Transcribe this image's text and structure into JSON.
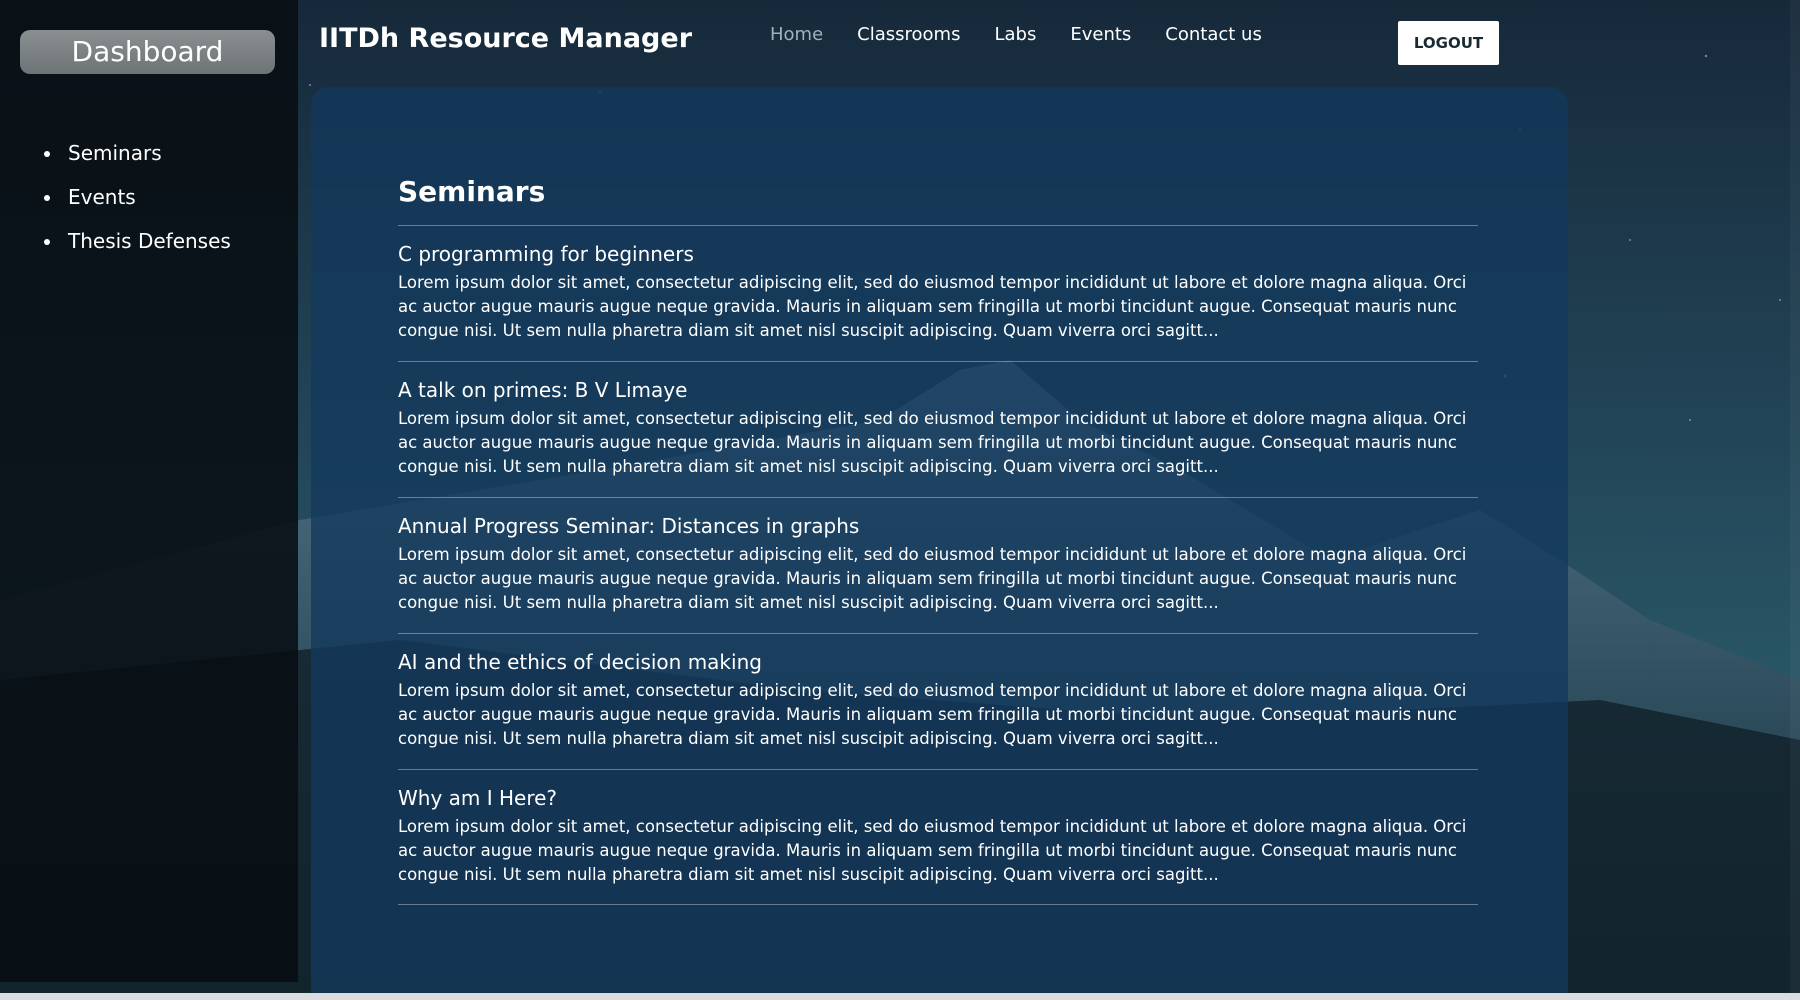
{
  "app": {
    "brand": "IITDh Resource Manager"
  },
  "sidebar": {
    "dashboard_label": "Dashboard",
    "items": [
      {
        "label": "Seminars"
      },
      {
        "label": "Events"
      },
      {
        "label": "Thesis Defenses"
      }
    ]
  },
  "nav": {
    "links": [
      {
        "label": "Home",
        "active": true
      },
      {
        "label": "Classrooms"
      },
      {
        "label": "Labs"
      },
      {
        "label": "Events"
      },
      {
        "label": "Contact us"
      }
    ],
    "logout_label": "LOGOUT"
  },
  "main": {
    "title": "Seminars",
    "seminars": [
      {
        "title": "C programming for beginners",
        "desc": "Lorem ipsum dolor sit amet, consectetur adipiscing elit, sed do eiusmod tempor incididunt ut labore et dolore magna aliqua. Orci ac auctor augue mauris augue neque gravida. Mauris in aliquam sem fringilla ut morbi tincidunt augue. Consequat mauris nunc congue nisi. Ut sem nulla pharetra diam sit amet nisl suscipit adipiscing. Quam viverra orci sagitt..."
      },
      {
        "title": "A talk on primes: B V Limaye",
        "desc": "Lorem ipsum dolor sit amet, consectetur adipiscing elit, sed do eiusmod tempor incididunt ut labore et dolore magna aliqua. Orci ac auctor augue mauris augue neque gravida. Mauris in aliquam sem fringilla ut morbi tincidunt augue. Consequat mauris nunc congue nisi. Ut sem nulla pharetra diam sit amet nisl suscipit adipiscing. Quam viverra orci sagitt..."
      },
      {
        "title": "Annual Progress Seminar: Distances in graphs",
        "desc": "Lorem ipsum dolor sit amet, consectetur adipiscing elit, sed do eiusmod tempor incididunt ut labore et dolore magna aliqua. Orci ac auctor augue mauris augue neque gravida. Mauris in aliquam sem fringilla ut morbi tincidunt augue. Consequat mauris nunc congue nisi. Ut sem nulla pharetra diam sit amet nisl suscipit adipiscing. Quam viverra orci sagitt..."
      },
      {
        "title": "AI and the ethics of decision making",
        "desc": "Lorem ipsum dolor sit amet, consectetur adipiscing elit, sed do eiusmod tempor incididunt ut labore et dolore magna aliqua. Orci ac auctor augue mauris augue neque gravida. Mauris in aliquam sem fringilla ut morbi tincidunt augue. Consequat mauris nunc congue nisi. Ut sem nulla pharetra diam sit amet nisl suscipit adipiscing. Quam viverra orci sagitt..."
      },
      {
        "title": "Why am I Here?",
        "desc": "Lorem ipsum dolor sit amet, consectetur adipiscing elit, sed do eiusmod tempor incididunt ut labore et dolore magna aliqua. Orci ac auctor augue mauris augue neque gravida. Mauris in aliquam sem fringilla ut morbi tincidunt augue. Consequat mauris nunc congue nisi. Ut sem nulla pharetra diam sit amet nisl suscipit adipiscing. Quam viverra orci sagitt..."
      }
    ]
  }
}
